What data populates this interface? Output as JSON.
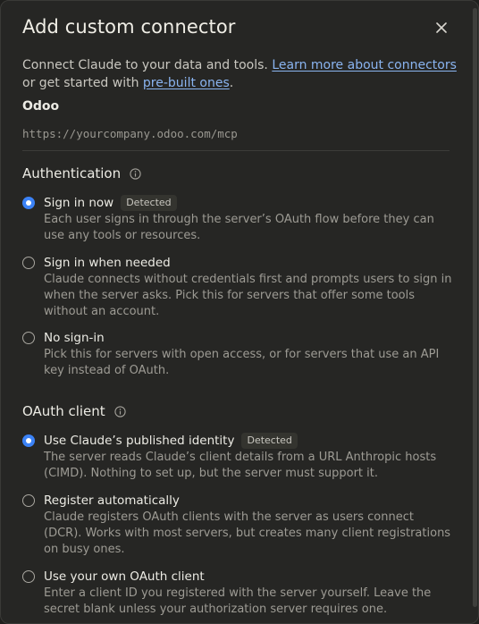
{
  "dialog": {
    "title": "Add custom connector",
    "intro_text": "Connect Claude to your data and tools. ",
    "learn_link": "Learn more about connectors",
    "or_text": " or get started with ",
    "prebuilt_link": "pre-built ones",
    "period": "."
  },
  "connector": {
    "name": "Odoo",
    "url_placeholder": "https://yourcompany.odoo.com/mcp"
  },
  "authentication": {
    "title": "Authentication",
    "options": [
      {
        "label": "Sign in now",
        "badge": "Detected",
        "selected": true,
        "description": "Each user signs in through the server’s OAuth flow before they can use any tools or resources."
      },
      {
        "label": "Sign in when needed",
        "selected": false,
        "description": "Claude connects without credentials first and prompts users to sign in when the server asks. Pick this for servers that offer some tools without an account."
      },
      {
        "label": "No sign-in",
        "selected": false,
        "description": "Pick this for servers with open access, or for servers that use an API key instead of OAuth."
      }
    ]
  },
  "oauth_client": {
    "title": "OAuth client",
    "options": [
      {
        "label": "Use Claude’s published identity",
        "badge": "Detected",
        "selected": true,
        "description": "The server reads Claude’s client details from a URL Anthropic hosts (CIMD). Nothing to set up, but the server must support it."
      },
      {
        "label": "Register automatically",
        "selected": false,
        "description": "Claude registers OAuth clients with the server as users connect (DCR). Works with most servers, but creates many client registrations on busy ones."
      },
      {
        "label": "Use your own OAuth client",
        "selected": false,
        "description": "Enter a client ID you registered with the server yourself. Leave the secret blank unless your authorization server requires one."
      }
    ]
  },
  "colors": {
    "accent": "#3b82f6",
    "link": "#8ab4f0"
  }
}
